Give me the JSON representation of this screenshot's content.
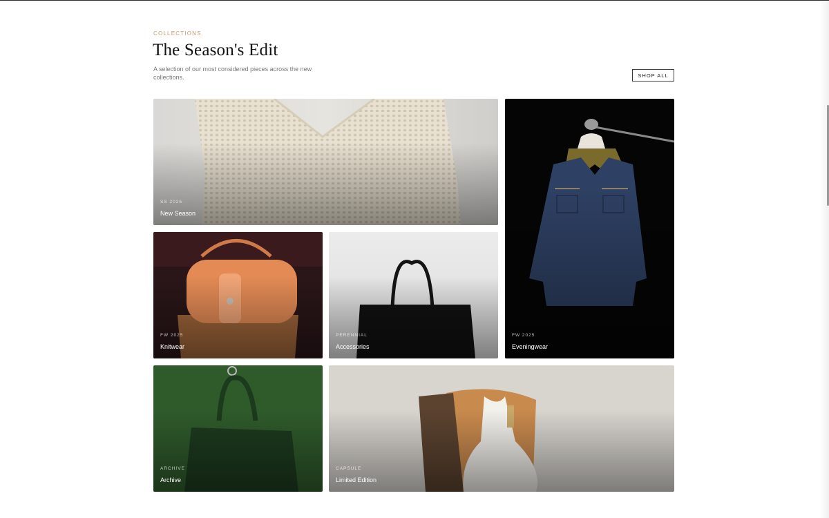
{
  "header": {
    "eyebrow": "COLLECTIONS",
    "title": "The Season's Edit",
    "subtitle": "A selection of our most considered pieces across the new collections.",
    "shop_all": "SHOP ALL"
  },
  "tiles": [
    {
      "tag": "SS 2026",
      "name": "New Season"
    },
    {
      "tag": "FW 2025",
      "name": "Eveningwear"
    },
    {
      "tag": "FW 2025",
      "name": "Knitwear"
    },
    {
      "tag": "PERENNIAL",
      "name": "Accessories"
    },
    {
      "tag": "ARCHIVE",
      "name": "Archive"
    },
    {
      "tag": "CAPSULE",
      "name": "Limited Edition"
    }
  ],
  "colors": {
    "accent": "#c79a6b",
    "text": "#111111",
    "muted": "#7a7a7a"
  }
}
